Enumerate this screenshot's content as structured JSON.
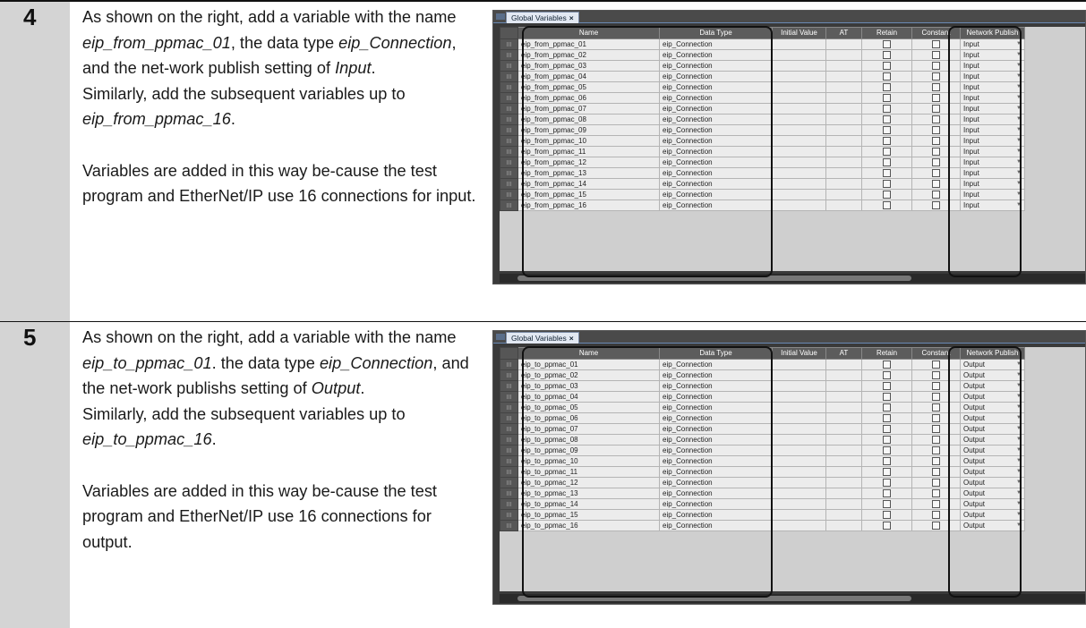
{
  "steps": [
    {
      "number": "4",
      "text": {
        "p1_parts": [
          "As shown on the right, add a variable with the name ",
          "eip_from_ppmac_01",
          ", the data type ",
          "eip_Connection",
          ", and the net-work publish setting of ",
          "Input",
          "."
        ],
        "p2_parts": [
          "Similarly, add the subsequent variables up to ",
          "eip_from_ppmac_16",
          "."
        ],
        "p3": "Variables are added in this way be-cause the test program and EtherNet/IP use 16 connections for input."
      },
      "screenshot": {
        "tab_label": "Global Variables",
        "tab_close": "×",
        "headers": [
          "Name",
          "Data Type",
          "Initial Value",
          "AT",
          "Retain",
          "Constant",
          "Network Publish"
        ],
        "rows": [
          {
            "name": "eip_from_ppmac_01",
            "type": "eip_Connection",
            "publish": "Input"
          },
          {
            "name": "eip_from_ppmac_02",
            "type": "eip_Connection",
            "publish": "Input"
          },
          {
            "name": "eip_from_ppmac_03",
            "type": "eip_Connection",
            "publish": "Input"
          },
          {
            "name": "eip_from_ppmac_04",
            "type": "eip_Connection",
            "publish": "Input"
          },
          {
            "name": "eip_from_ppmac_05",
            "type": "eip_Connection",
            "publish": "Input"
          },
          {
            "name": "eip_from_ppmac_06",
            "type": "eip_Connection",
            "publish": "Input"
          },
          {
            "name": "eip_from_ppmac_07",
            "type": "eip_Connection",
            "publish": "Input"
          },
          {
            "name": "eip_from_ppmac_08",
            "type": "eip_Connection",
            "publish": "Input"
          },
          {
            "name": "eip_from_ppmac_09",
            "type": "eip_Connection",
            "publish": "Input"
          },
          {
            "name": "eip_from_ppmac_10",
            "type": "eip_Connection",
            "publish": "Input"
          },
          {
            "name": "eip_from_ppmac_11",
            "type": "eip_Connection",
            "publish": "Input"
          },
          {
            "name": "eip_from_ppmac_12",
            "type": "eip_Connection",
            "publish": "Input"
          },
          {
            "name": "eip_from_ppmac_13",
            "type": "eip_Connection",
            "publish": "Input"
          },
          {
            "name": "eip_from_ppmac_14",
            "type": "eip_Connection",
            "publish": "Input"
          },
          {
            "name": "eip_from_ppmac_15",
            "type": "eip_Connection",
            "publish": "Input"
          },
          {
            "name": "eip_from_ppmac_16",
            "type": "eip_Connection",
            "publish": "Input"
          }
        ]
      }
    },
    {
      "number": "5",
      "text": {
        "p1_parts": [
          "As shown on the right, add a variable with the name ",
          "eip_to_ppmac_01",
          ". the data type ",
          "eip_Connection",
          ", and the net-work publishs setting of ",
          "Output",
          "."
        ],
        "p2_parts": [
          "Similarly, add the subsequent variables up to ",
          "eip_to_ppmac_16",
          "."
        ],
        "p3": "Variables are added in this way be-cause the test program and EtherNet/IP use 16 connections for output."
      },
      "screenshot": {
        "tab_label": "Global Variables",
        "tab_close": "×",
        "headers": [
          "Name",
          "Data Type",
          "Initial Value",
          "AT",
          "Retain",
          "Constant",
          "Network Publish"
        ],
        "rows": [
          {
            "name": "eip_to_ppmac_01",
            "type": "eip_Connection",
            "publish": "Output"
          },
          {
            "name": "eip_to_ppmac_02",
            "type": "eip_Connection",
            "publish": "Output"
          },
          {
            "name": "eip_to_ppmac_03",
            "type": "eip_Connection",
            "publish": "Output"
          },
          {
            "name": "eip_to_ppmac_04",
            "type": "eip_Connection",
            "publish": "Output"
          },
          {
            "name": "eip_to_ppmac_05",
            "type": "eip_Connection",
            "publish": "Output"
          },
          {
            "name": "eip_to_ppmac_06",
            "type": "eip_Connection",
            "publish": "Output"
          },
          {
            "name": "eip_to_ppmac_07",
            "type": "eip_Connection",
            "publish": "Output"
          },
          {
            "name": "eip_to_ppmac_08",
            "type": "eip_Connection",
            "publish": "Output"
          },
          {
            "name": "eip_to_ppmac_09",
            "type": "eip_Connection",
            "publish": "Output"
          },
          {
            "name": "eip_to_ppmac_10",
            "type": "eip_Connection",
            "publish": "Output"
          },
          {
            "name": "eip_to_ppmac_11",
            "type": "eip_Connection",
            "publish": "Output"
          },
          {
            "name": "eip_to_ppmac_12",
            "type": "eip_Connection",
            "publish": "Output"
          },
          {
            "name": "eip_to_ppmac_13",
            "type": "eip_Connection",
            "publish": "Output"
          },
          {
            "name": "eip_to_ppmac_14",
            "type": "eip_Connection",
            "publish": "Output"
          },
          {
            "name": "eip_to_ppmac_15",
            "type": "eip_Connection",
            "publish": "Output"
          },
          {
            "name": "eip_to_ppmac_16",
            "type": "eip_Connection",
            "publish": "Output"
          }
        ]
      }
    }
  ],
  "colors": {
    "step_number_bg": "#d4d4d4",
    "grid_header_bg": "#5c5c5c",
    "grid_cell_bg": "#ececec",
    "tab_bg": "#e2e8f2",
    "highlight_border": "#111111"
  },
  "icons": {
    "dropdown": "triangle-down-icon",
    "checkbox": "checkbox-unchecked-icon",
    "tab_close": "close-icon"
  }
}
